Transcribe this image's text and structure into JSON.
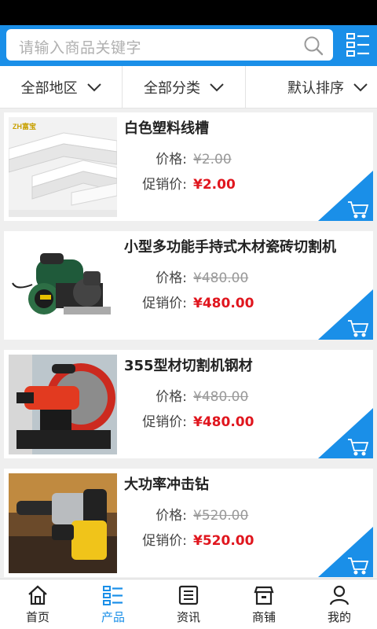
{
  "search": {
    "placeholder": "请输入商品关键字"
  },
  "filters": [
    {
      "label": "全部地区"
    },
    {
      "label": "全部分类"
    },
    {
      "label": "默认排序"
    }
  ],
  "products": [
    {
      "title": "白色塑料线槽",
      "price_label": "价格:",
      "price": "¥2.00",
      "sale_label": "促销价:",
      "sale": "¥2.00",
      "brand_text": "ZH富宝"
    },
    {
      "title": "小型多功能手持式木材瓷砖切割机",
      "price_label": "价格:",
      "price": "¥480.00",
      "sale_label": "促销价:",
      "sale": "¥480.00"
    },
    {
      "title": "355型材切割机钢材",
      "price_label": "价格:",
      "price": "¥480.00",
      "sale_label": "促销价:",
      "sale": "¥480.00"
    },
    {
      "title": "大功率冲击钻",
      "price_label": "价格:",
      "price": "¥520.00",
      "sale_label": "促销价:",
      "sale": "¥520.00"
    }
  ],
  "tabs": [
    {
      "label": "首页",
      "icon": "home-icon"
    },
    {
      "label": "产品",
      "icon": "list-icon"
    },
    {
      "label": "资讯",
      "icon": "news-icon"
    },
    {
      "label": "商铺",
      "icon": "shop-icon"
    },
    {
      "label": "我的",
      "icon": "user-icon"
    }
  ],
  "colors": {
    "accent": "#1a8fe8",
    "sale": "#e0161e",
    "strike": "#999999"
  }
}
